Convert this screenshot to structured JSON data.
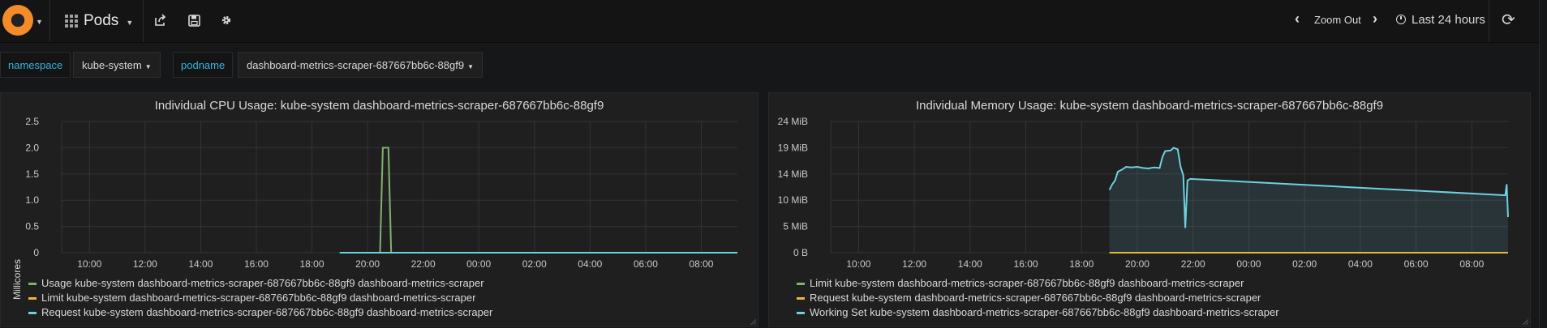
{
  "navbar": {
    "dashboard_title": "Pods",
    "zoom_label": "Zoom Out",
    "time_range": "Last 24 hours"
  },
  "variables": [
    {
      "label": "namespace",
      "value": "kube-system"
    },
    {
      "label": "podname",
      "value": "dashboard-metrics-scraper-687667bb6c-88gf9"
    }
  ],
  "colors": {
    "green": "#7eb26d",
    "yellow": "#eab839",
    "cyan": "#6ed0e0",
    "link": "#33b5e5"
  },
  "chart_data": [
    {
      "type": "line",
      "title": "Individual CPU Usage: kube-system dashboard-metrics-scraper-687667bb6c-88gf9",
      "ylabel": "Millicores",
      "ylim": [
        0,
        2.5
      ],
      "yticks": [
        "2.5",
        "2.0",
        "1.5",
        "1.0",
        "0.5",
        "0"
      ],
      "xticks": [
        "10:00",
        "12:00",
        "14:00",
        "16:00",
        "18:00",
        "20:00",
        "22:00",
        "00:00",
        "02:00",
        "04:00",
        "06:00",
        "08:00"
      ],
      "series": [
        {
          "name": "Usage kube-system dashboard-metrics-scraper-687667bb6c-88gf9 dashboard-metrics-scraper",
          "color": "green",
          "points": [
            [
              19.0,
              0
            ],
            [
              20.45,
              0
            ],
            [
              20.55,
              2.0
            ],
            [
              20.75,
              2.0
            ],
            [
              20.85,
              0
            ],
            [
              33.3,
              0
            ]
          ]
        },
        {
          "name": "Limit kube-system dashboard-metrics-scraper-687667bb6c-88gf9 dashboard-metrics-scraper",
          "color": "yellow",
          "points": []
        },
        {
          "name": "Request kube-system dashboard-metrics-scraper-687667bb6c-88gf9 dashboard-metrics-scraper",
          "color": "cyan",
          "points": [
            [
              19.0,
              0
            ],
            [
              33.3,
              0
            ]
          ]
        }
      ]
    },
    {
      "type": "area",
      "title": "Individual Memory Usage: kube-system dashboard-metrics-scraper-687667bb6c-88gf9",
      "ylabel": "",
      "ylim": [
        0,
        24
      ],
      "yticks": [
        "24 MiB",
        "19 MiB",
        "14 MiB",
        "10 MiB",
        "5 MiB",
        "0 B"
      ],
      "xticks": [
        "10:00",
        "12:00",
        "14:00",
        "16:00",
        "18:00",
        "20:00",
        "22:00",
        "00:00",
        "02:00",
        "04:00",
        "06:00",
        "08:00"
      ],
      "series": [
        {
          "name": "Limit kube-system dashboard-metrics-scraper-687667bb6c-88gf9 dashboard-metrics-scraper",
          "color": "green",
          "points": []
        },
        {
          "name": "Request kube-system dashboard-metrics-scraper-687667bb6c-88gf9 dashboard-metrics-scraper",
          "color": "yellow",
          "points": [
            [
              19.0,
              0
            ],
            [
              33.3,
              0
            ]
          ]
        },
        {
          "name": "Working Set kube-system dashboard-metrics-scraper-687667bb6c-88gf9 dashboard-metrics-scraper",
          "color": "cyan",
          "fill": true,
          "points": [
            [
              19.0,
              11.5
            ],
            [
              19.1,
              12.5
            ],
            [
              19.2,
              13.2
            ],
            [
              19.3,
              14.8
            ],
            [
              19.45,
              15.2
            ],
            [
              19.6,
              15.7
            ],
            [
              19.8,
              15.6
            ],
            [
              20.0,
              15.7
            ],
            [
              20.2,
              15.5
            ],
            [
              20.4,
              15.4
            ],
            [
              20.6,
              15.6
            ],
            [
              20.8,
              15.5
            ],
            [
              20.9,
              17.5
            ],
            [
              21.0,
              18.6
            ],
            [
              21.2,
              18.7
            ],
            [
              21.3,
              19.2
            ],
            [
              21.45,
              18.9
            ],
            [
              21.55,
              15.8
            ],
            [
              21.65,
              14.1
            ],
            [
              21.72,
              4.5
            ],
            [
              21.8,
              13.2
            ],
            [
              21.9,
              13.5
            ],
            [
              33.2,
              10.5
            ],
            [
              33.25,
              12.5
            ],
            [
              33.3,
              6.5
            ]
          ]
        }
      ]
    }
  ]
}
